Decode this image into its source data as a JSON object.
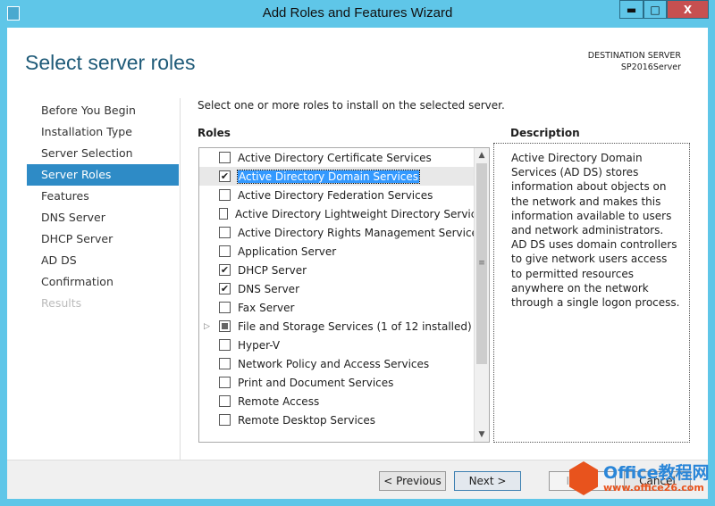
{
  "window": {
    "title": "Add Roles and Features Wizard",
    "min": "▬",
    "max": "□",
    "close": "X"
  },
  "header": {
    "title": "Select server roles",
    "dest_label": "DESTINATION SERVER",
    "dest_server": "SP2016Server"
  },
  "nav": [
    {
      "label": "Before You Begin",
      "state": "normal"
    },
    {
      "label": "Installation Type",
      "state": "normal"
    },
    {
      "label": "Server Selection",
      "state": "normal"
    },
    {
      "label": "Server Roles",
      "state": "selected"
    },
    {
      "label": "Features",
      "state": "normal"
    },
    {
      "label": "DNS Server",
      "state": "normal"
    },
    {
      "label": "DHCP Server",
      "state": "normal"
    },
    {
      "label": "AD DS",
      "state": "normal"
    },
    {
      "label": "Confirmation",
      "state": "normal"
    },
    {
      "label": "Results",
      "state": "disabled"
    }
  ],
  "main": {
    "intro": "Select one or more roles to install on the selected server.",
    "roles_heading": "Roles",
    "description_heading": "Description",
    "description": "Active Directory Domain Services (AD DS) stores information about objects on the network and makes this information available to users and network administrators. AD DS uses domain controllers to give network users access to permitted resources anywhere on the network through a single logon process."
  },
  "roles": [
    {
      "label": "Active Directory Certificate Services",
      "checked": false
    },
    {
      "label": "Active Directory Domain Services",
      "checked": true,
      "selected": true
    },
    {
      "label": "Active Directory Federation Services",
      "checked": false
    },
    {
      "label": "Active Directory Lightweight Directory Services",
      "checked": false
    },
    {
      "label": "Active Directory Rights Management Services",
      "checked": false
    },
    {
      "label": "Application Server",
      "checked": false
    },
    {
      "label": "DHCP Server",
      "checked": true
    },
    {
      "label": "DNS Server",
      "checked": true
    },
    {
      "label": "Fax Server",
      "checked": false
    },
    {
      "label": "File and Storage Services (1 of 12 installed)",
      "checked": "partial",
      "expandable": true
    },
    {
      "label": "Hyper-V",
      "checked": false
    },
    {
      "label": "Network Policy and Access Services",
      "checked": false
    },
    {
      "label": "Print and Document Services",
      "checked": false
    },
    {
      "label": "Remote Access",
      "checked": false
    },
    {
      "label": "Remote Desktop Services",
      "checked": false
    }
  ],
  "footer": {
    "previous": "< Previous",
    "next": "Next >",
    "install": "Install",
    "cancel": "Cancel"
  },
  "watermark": {
    "brand": "Office教程网",
    "url": "www.office26.com"
  }
}
